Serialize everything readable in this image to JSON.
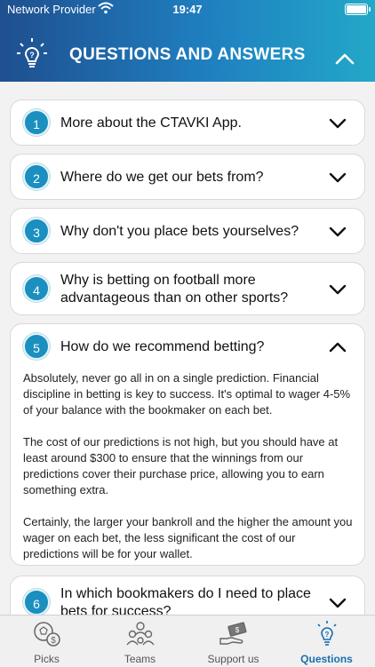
{
  "status": {
    "carrier": "Network Provider",
    "time": "19:47"
  },
  "header": {
    "title": "QUESTIONS AND ANSWERS",
    "icon": "lightbulb-question-icon",
    "collapse_icon": "chevron-up-icon"
  },
  "faq": [
    {
      "num": "1",
      "question": "More about the CTAVKI App.",
      "expanded": false
    },
    {
      "num": "2",
      "question": "Where do we get our bets from?",
      "expanded": false
    },
    {
      "num": "3",
      "question": "Why don't you place bets yourselves?",
      "expanded": false
    },
    {
      "num": "4",
      "question": "Why is betting on football more advantageous than on other sports?",
      "expanded": false
    },
    {
      "num": "5",
      "question": "How do we recommend betting?",
      "expanded": true,
      "answer": [
        "Absolutely, never go all in on a single prediction. Financial discipline in betting is key to success. It's optimal to wager 4-5% of your balance with the bookmaker on each bet.",
        "The cost of our predictions is not high, but you should have at least around $300 to ensure that the winnings from our predictions cover their purchase price, allowing you to earn something extra.",
        "Certainly, the larger your bankroll and the higher the amount you wager on each bet, the less significant the cost of our predictions will be for your wallet."
      ]
    },
    {
      "num": "6",
      "question": "In which bookmakers do I need to place bets for success?",
      "expanded": false
    }
  ],
  "tabs": [
    {
      "label": "Picks",
      "icon": "picks-icon",
      "active": false
    },
    {
      "label": "Teams",
      "icon": "teams-icon",
      "active": false
    },
    {
      "label": "Support us",
      "icon": "support-icon",
      "active": false
    },
    {
      "label": "Questions",
      "icon": "questions-icon",
      "active": true
    }
  ],
  "colors": {
    "accent": "#1a8fc0",
    "header_start": "#1f4f8f",
    "header_end": "#22a8c8",
    "active_tab": "#1a6fb0"
  }
}
